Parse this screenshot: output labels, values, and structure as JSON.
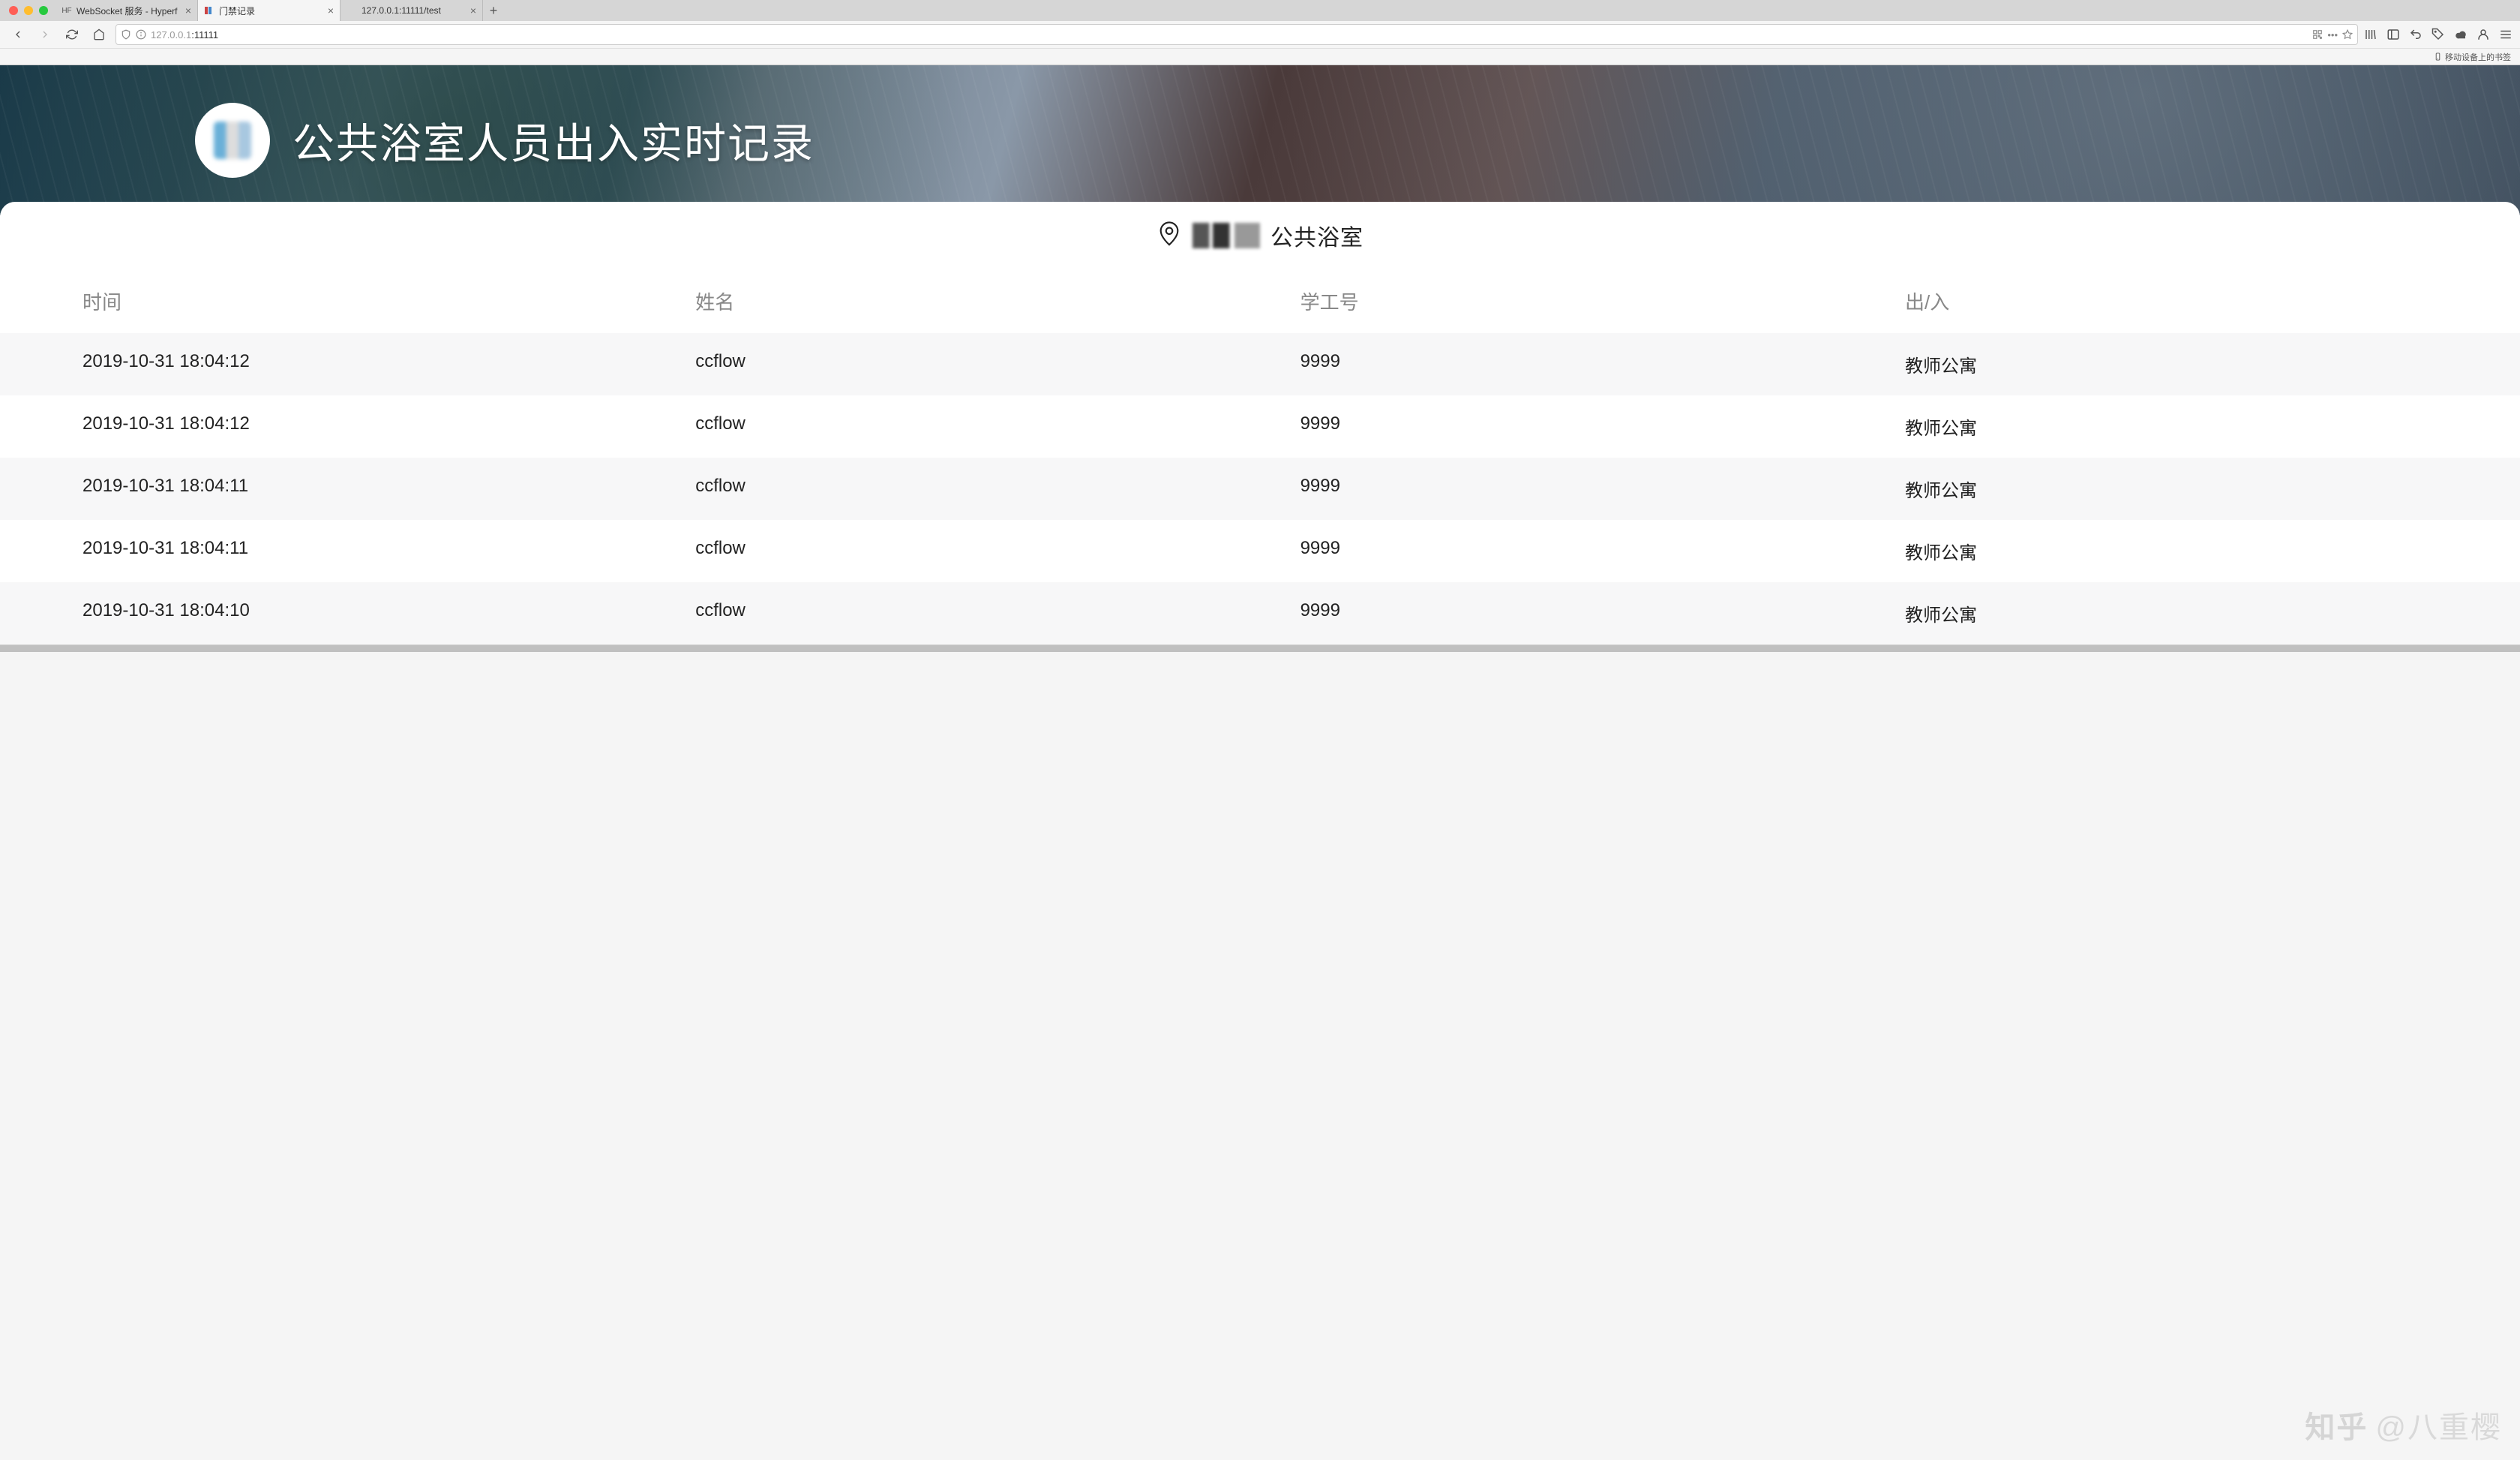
{
  "browser": {
    "tabs": [
      {
        "title": "WebSocket 服务 - Hyperf",
        "favicon": "HF",
        "active": false
      },
      {
        "title": "门禁记录",
        "favicon": "",
        "active": true
      },
      {
        "title": "127.0.0.1:11111/test",
        "favicon": "",
        "active": false
      }
    ],
    "address": {
      "scheme_icon": "info",
      "host": "127.0.0.1",
      "port": ":11111"
    },
    "bookmark_bar": {
      "mobile_label": "移动设备上的书签"
    }
  },
  "page": {
    "hero_title": "公共浴室人员出入实时记录",
    "location_suffix": "公共浴室",
    "table": {
      "headers": {
        "time": "时间",
        "name": "姓名",
        "id": "学工号",
        "direction": "出/入"
      },
      "rows": [
        {
          "time": "2019-10-31 18:04:12",
          "name": "ccflow",
          "id": "9999",
          "direction": "教师公寓"
        },
        {
          "time": "2019-10-31 18:04:12",
          "name": "ccflow",
          "id": "9999",
          "direction": "教师公寓"
        },
        {
          "time": "2019-10-31 18:04:11",
          "name": "ccflow",
          "id": "9999",
          "direction": "教师公寓"
        },
        {
          "time": "2019-10-31 18:04:11",
          "name": "ccflow",
          "id": "9999",
          "direction": "教师公寓"
        },
        {
          "time": "2019-10-31 18:04:10",
          "name": "ccflow",
          "id": "9999",
          "direction": "教师公寓"
        }
      ]
    }
  },
  "watermark": {
    "brand": "知乎",
    "user": "@八重樱"
  }
}
